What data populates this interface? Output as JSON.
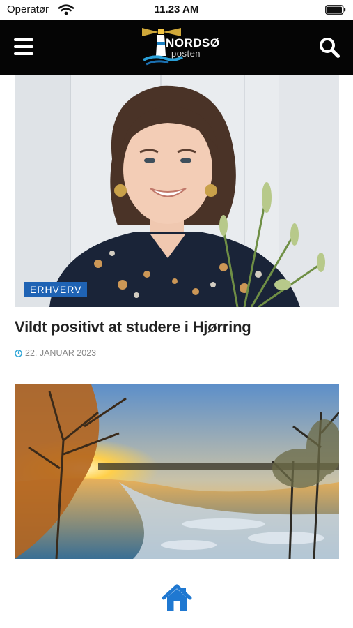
{
  "status_bar": {
    "carrier": "Operatør",
    "time": "11.23 AM"
  },
  "header": {
    "logo_name": "NORDSØ",
    "logo_sub": "posten",
    "menu_icon": "hamburger-menu-icon",
    "search_icon": "search-icon"
  },
  "articles": [
    {
      "category": "ERHVERV",
      "title": "Vildt positivt at studere i Hjørring",
      "date": "22. JANUAR 2023"
    }
  ],
  "bottom_nav": {
    "home_icon": "home-icon"
  },
  "colors": {
    "header_bg": "#050505",
    "accent_blue": "#1f63b4",
    "clock_icon": "#2aa3d6",
    "home_icon": "#1f78d1",
    "meta_text": "#888888"
  }
}
